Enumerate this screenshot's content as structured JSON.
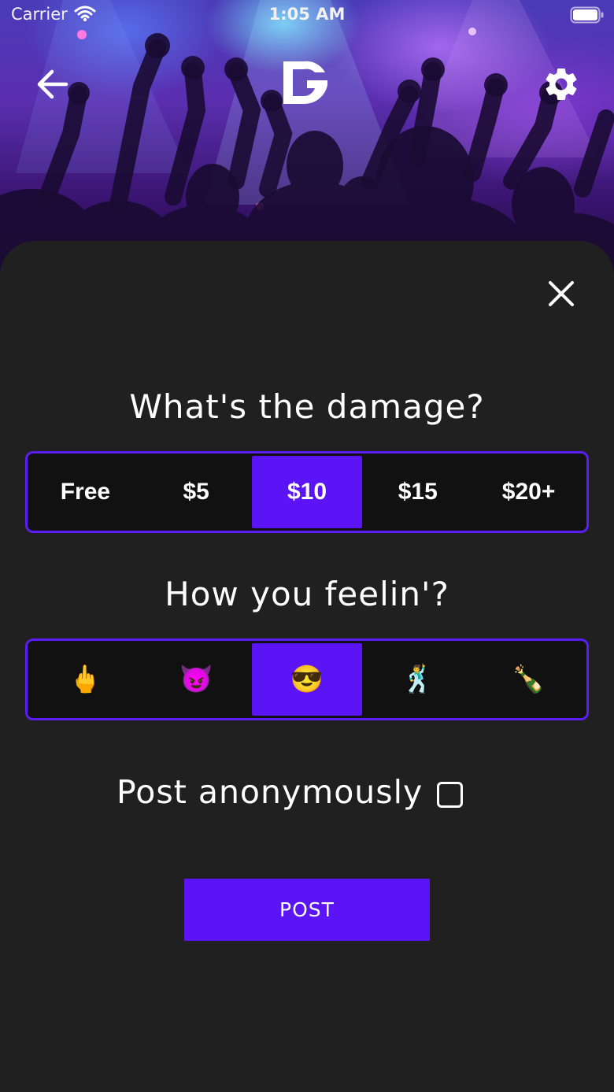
{
  "status_bar": {
    "carrier": "Carrier",
    "time": "1:05 AM"
  },
  "header": {
    "back_icon": "arrow-left-icon",
    "logo": "app-logo",
    "settings_icon": "gear-icon"
  },
  "sheet": {
    "close_icon": "close-icon",
    "damage_question": "What's the damage?",
    "price_options": [
      {
        "label": "Free",
        "selected": false
      },
      {
        "label": "$5",
        "selected": false
      },
      {
        "label": "$10",
        "selected": true
      },
      {
        "label": "$15",
        "selected": false
      },
      {
        "label": "$20+",
        "selected": false
      }
    ],
    "feeling_question": "How you feelin'?",
    "mood_options": [
      {
        "label": "🖕",
        "icon": "middle-finger-emoji",
        "selected": false
      },
      {
        "label": "😈",
        "icon": "smiling-devil-emoji",
        "selected": false
      },
      {
        "label": "😎",
        "icon": "sunglasses-face-emoji",
        "selected": true
      },
      {
        "label": "🕺",
        "icon": "dancing-man-emoji",
        "selected": false
      },
      {
        "label": "🍾",
        "icon": "champagne-bottle-emoji",
        "selected": false
      }
    ],
    "anonymous_label": "Post anonymously",
    "anonymous_checked": false,
    "post_label": "POST"
  },
  "colors": {
    "accent": "#5B14F5",
    "sheet_background": "#202020",
    "segment_background": "#111111"
  }
}
